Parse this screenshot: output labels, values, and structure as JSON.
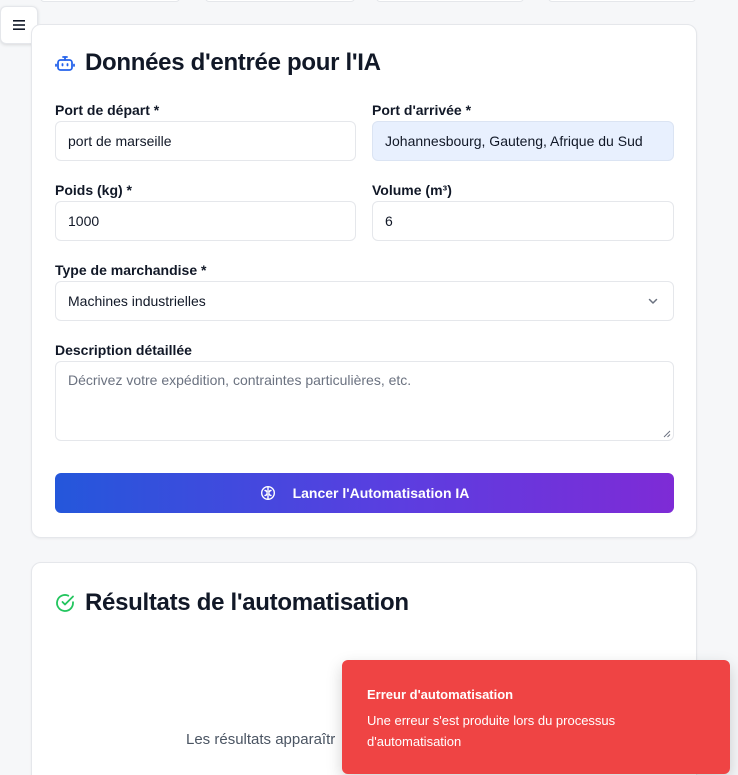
{
  "colors": {
    "accent_blue": "#2563eb",
    "accent_purple": "#7e22ce",
    "success_green": "#22c55e",
    "error_red": "#ef4444",
    "autofill_bg": "#e8f0fe"
  },
  "sidebar_toggle": {
    "icon": "menu-icon"
  },
  "input_card": {
    "title": "Données d'entrée pour l'IA",
    "icon": "robot-icon",
    "fields": {
      "departure_port": {
        "label": "Port de départ *",
        "value": "port de marseille"
      },
      "arrival_port": {
        "label": "Port d'arrivée *",
        "value": "Johannesbourg, Gauteng, Afrique du Sud"
      },
      "weight": {
        "label": "Poids (kg) *",
        "value": "1000"
      },
      "volume": {
        "label": "Volume (m³)",
        "value": "6"
      },
      "goods_type": {
        "label": "Type de marchandise *",
        "value": "Machines industrielles"
      },
      "description": {
        "label": "Description détaillée",
        "placeholder": "Décrivez votre expédition, contraintes particulières, etc."
      }
    },
    "launch_button": {
      "label": "Lancer l'Automatisation IA",
      "icon": "brain-icon"
    }
  },
  "results_card": {
    "title": "Résultats de l'automatisation",
    "icon": "check-circle-icon",
    "empty_text": "Les résultats apparaîtr"
  },
  "toast": {
    "title": "Erreur d'automatisation",
    "message": "Une erreur s'est produite lors du processus d'automatisation"
  }
}
